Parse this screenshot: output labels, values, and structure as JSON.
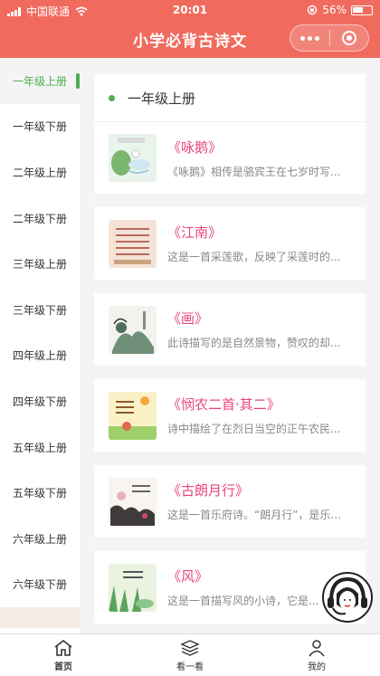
{
  "status_bar": {
    "carrier": "中国联通",
    "time": "20:01",
    "battery": "56%"
  },
  "header": {
    "title": "小学必背古诗文"
  },
  "sidebar": {
    "items": [
      {
        "label": "一年级上册",
        "active": true
      },
      {
        "label": "一年级下册"
      },
      {
        "label": "二年级上册"
      },
      {
        "label": "二年级下册"
      },
      {
        "label": "三年级上册"
      },
      {
        "label": "三年级下册"
      },
      {
        "label": "四年级上册"
      },
      {
        "label": "四年级下册"
      },
      {
        "label": "五年级上册"
      },
      {
        "label": "五年级下册"
      },
      {
        "label": "六年级上册"
      },
      {
        "label": "六年级下册"
      }
    ]
  },
  "main": {
    "section_title": "一年级上册",
    "poems": [
      {
        "title": "《咏鹅》",
        "desc": "《咏鹅》相传是骆宾王在七岁时写..."
      },
      {
        "title": "《江南》",
        "desc": "这是一首采莲歌，反映了采莲时的..."
      },
      {
        "title": "《画》",
        "desc": "此诗描写的是自然景物，赞叹的却..."
      },
      {
        "title": "《悯农二首·其二》",
        "desc": "诗中描绘了在烈日当空的正午农民..."
      },
      {
        "title": "《古朗月行》",
        "desc": "这是一首乐府诗。“朗月行”，是乐..."
      },
      {
        "title": "《风》",
        "desc": "这是一首描写风的小诗，它是..."
      }
    ]
  },
  "tabbar": {
    "tabs": [
      {
        "label": "首页",
        "icon": "home-icon",
        "active": true
      },
      {
        "label": "看一看",
        "icon": "layers-icon"
      },
      {
        "label": "我的",
        "icon": "user-icon"
      }
    ]
  },
  "colors": {
    "header": "#f06b5e",
    "accent_green": "#4caf50",
    "title_pink": "#e8457b"
  }
}
